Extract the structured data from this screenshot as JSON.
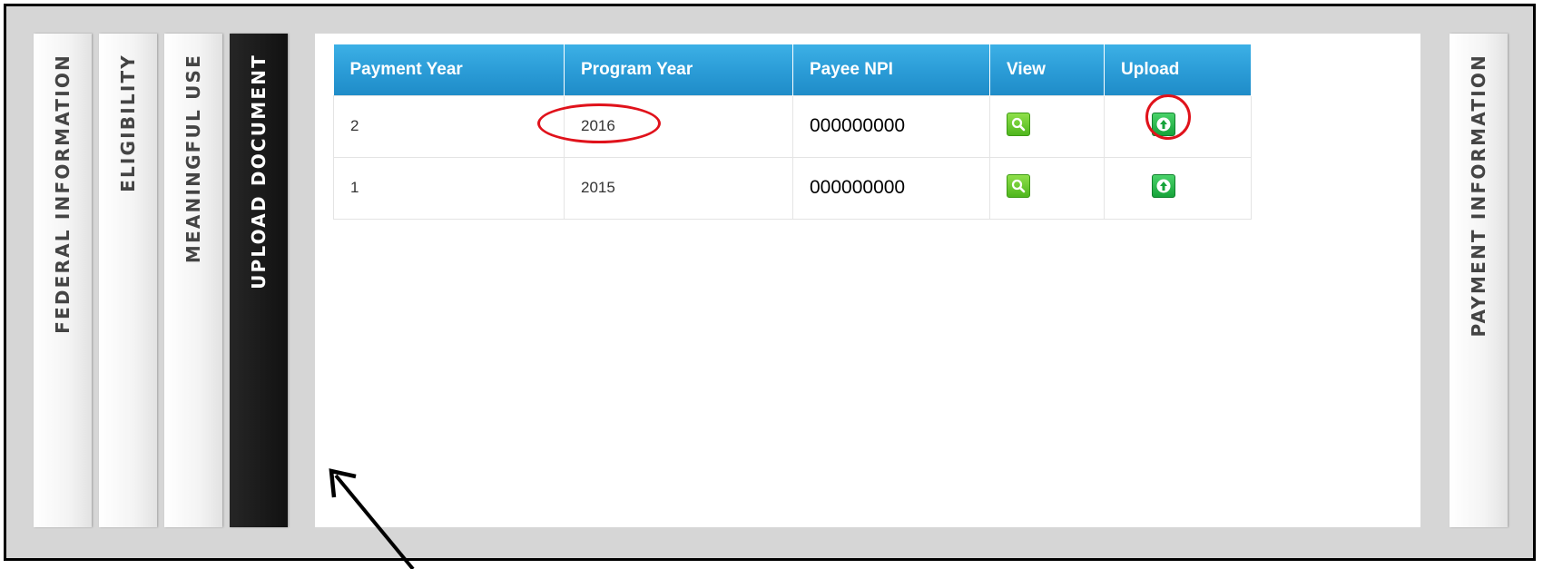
{
  "tabs": {
    "federal_information": "FEDERAL INFORMATION",
    "eligibility": "ELIGIBILITY",
    "meaningful_use": "MEANINGFUL USE",
    "upload_document": "UPLOAD DOCUMENT",
    "payment_information": "PAYMENT INFORMATION",
    "active": "upload_document"
  },
  "table": {
    "headers": [
      "Payment Year",
      "Program Year",
      "Payee NPI",
      "View",
      "Upload"
    ],
    "rows": [
      {
        "payment_year": "2",
        "program_year": "2016",
        "payee_npi": "000000000"
      },
      {
        "payment_year": "1",
        "program_year": "2015",
        "payee_npi": "000000000"
      }
    ]
  },
  "icons": {
    "view": "magnifier-icon",
    "upload": "upload-arrow-icon"
  },
  "colors": {
    "header_blue": "#2a9bd6",
    "annotation_red": "#e0121b",
    "active_tab": "#111111"
  }
}
